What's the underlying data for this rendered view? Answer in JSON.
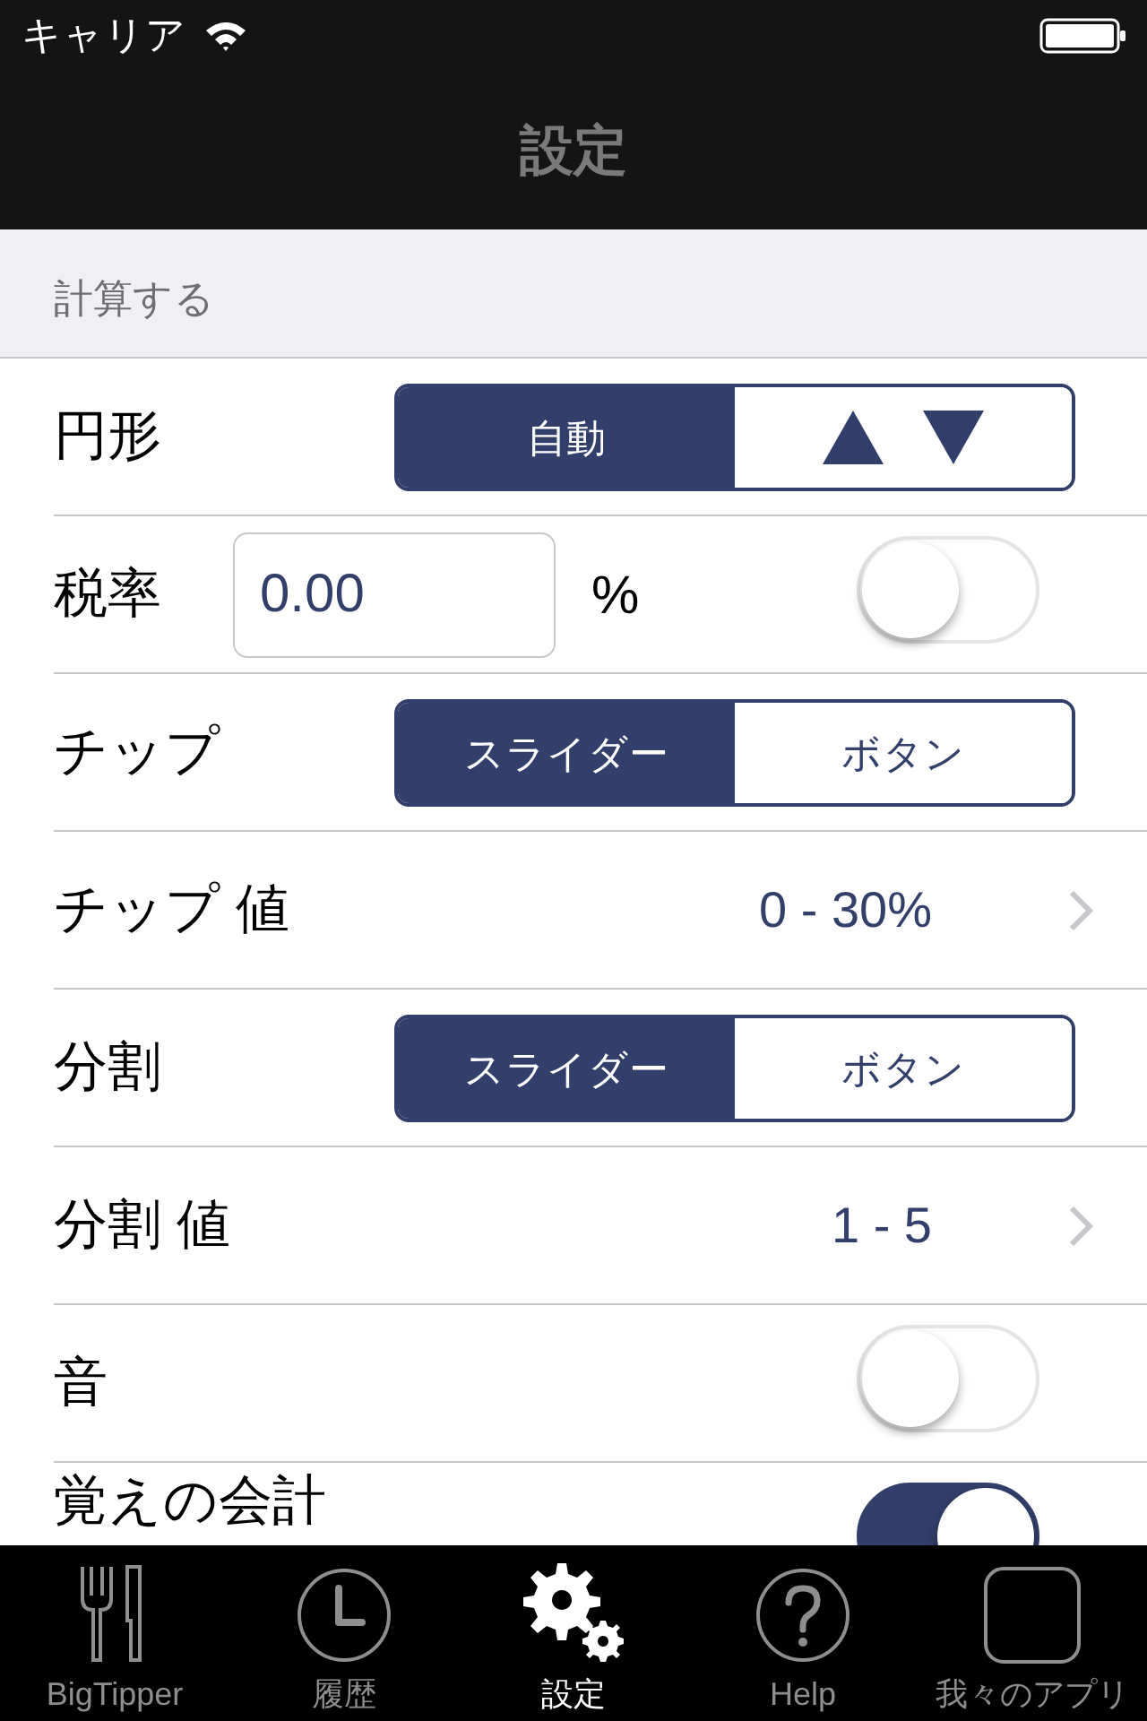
{
  "status_bar": {
    "carrier": "キャリア"
  },
  "nav_bar": {
    "title": "設定"
  },
  "section": {
    "header": "計算する",
    "rows": [
      {
        "kind": "segmented",
        "label": "円形",
        "segments": [
          {
            "kind": "text",
            "label": "自動",
            "selected": true
          },
          {
            "kind": "arrows",
            "selected": false
          }
        ]
      },
      {
        "kind": "input_toggle",
        "label": "税率",
        "value": "0.00",
        "unit": "%",
        "on": false
      },
      {
        "kind": "segmented",
        "label": "チップ",
        "segments": [
          {
            "kind": "text",
            "label": "スライダー",
            "selected": true
          },
          {
            "kind": "text",
            "label": "ボタン",
            "selected": false
          }
        ]
      },
      {
        "kind": "value",
        "label": "チップ 値",
        "value": "0 - 30%"
      },
      {
        "kind": "segmented",
        "label": "分割",
        "segments": [
          {
            "kind": "text",
            "label": "スライダー",
            "selected": true
          },
          {
            "kind": "text",
            "label": "ボタン",
            "selected": false
          }
        ]
      },
      {
        "kind": "value",
        "label": "分割 値",
        "value": "1 - 5"
      },
      {
        "kind": "toggle",
        "label": "音",
        "on": false
      },
      {
        "kind": "toggle",
        "label": "覚えの会計",
        "on": true
      }
    ]
  },
  "tab_bar": {
    "items": [
      {
        "kind": "fork_knife",
        "label": "BigTipper",
        "selected": false
      },
      {
        "kind": "clock",
        "label": "履歴",
        "selected": false
      },
      {
        "kind": "gears",
        "label": "設定",
        "selected": true
      },
      {
        "kind": "question",
        "label": "Help",
        "selected": false
      },
      {
        "kind": "square",
        "label": "我々のアプリ",
        "selected": false
      }
    ]
  }
}
